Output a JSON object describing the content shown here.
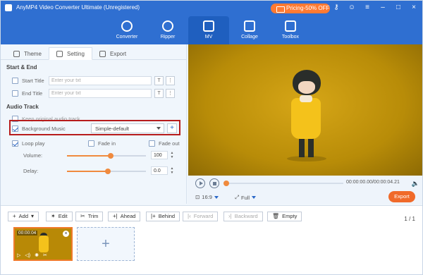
{
  "app": {
    "title": "AnyMP4 Video Converter Ultimate (Unregistered)",
    "pricing": "Pricing-50% OFF"
  },
  "nav": [
    {
      "label": "Converter"
    },
    {
      "label": "Ripper"
    },
    {
      "label": "MV"
    },
    {
      "label": "Collage"
    },
    {
      "label": "Toolbox"
    }
  ],
  "tabs": {
    "theme": "Theme",
    "setting": "Setting",
    "export": "Export"
  },
  "sections": {
    "start_end": "Start & End",
    "start_title": "Start Title",
    "end_title": "End Title",
    "placeholder": "Enter your txt",
    "audio_track": "Audio Track",
    "keep_original": "Keep original audio track",
    "background_music": "Background Music",
    "music_value": "Simple-default",
    "loop_play": "Loop play",
    "fade_in": "Fade in",
    "fade_out": "Fade out",
    "volume_label": "Volume:",
    "volume_value": "100",
    "delay_label": "Delay:",
    "delay_value": "0.0",
    "volume_level": 0.55,
    "delay_level": 0.52
  },
  "player": {
    "time": "00:00:00.00/00:00:04.21",
    "aspect": "16:9",
    "zoom": "Full",
    "export": "Export"
  },
  "toolbar": {
    "add": "Add",
    "edit": "Edit",
    "trim": "Trim",
    "ahead": "Ahead",
    "behind": "Behind",
    "forward": "Forward",
    "backward": "Backward",
    "empty": "Empty",
    "page": "1 / 1"
  },
  "clip": {
    "time": "00:00:04"
  }
}
